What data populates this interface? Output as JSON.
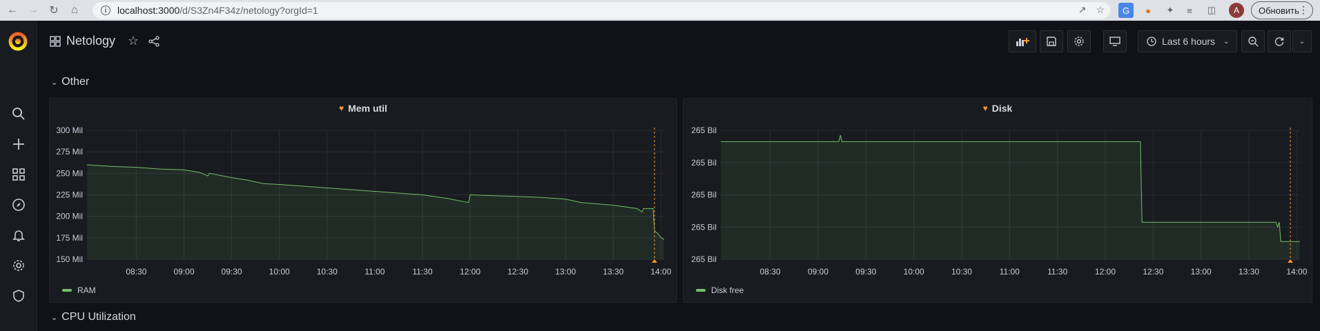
{
  "browser": {
    "url_host": "localhost:3000",
    "url_path": "/d/S3Zn4F34z/netology?orgId=1",
    "avatar_letter": "A",
    "update_label": "Обновить"
  },
  "dashboard": {
    "title": "Netology",
    "time_range": "Last 6 hours"
  },
  "rows": [
    {
      "title": "Other"
    },
    {
      "title": "CPU Utilization"
    }
  ],
  "panels": [
    {
      "title": "Mem util",
      "legend": "RAM"
    },
    {
      "title": "Disk",
      "legend": "Disk free"
    }
  ],
  "colors": {
    "series": "#73bf69",
    "accent": "#ff9830",
    "background": "#111217",
    "panel": "#181b1f"
  },
  "chart_data": [
    {
      "type": "line",
      "title": "Mem util",
      "series": [
        {
          "name": "RAM"
        }
      ],
      "y_tick_labels": [
        "150 Mil",
        "175 Mil",
        "200 Mil",
        "225 Mil",
        "250 Mil",
        "275 Mil",
        "300 Mil"
      ],
      "x_tick_labels": [
        "08:30",
        "09:00",
        "09:30",
        "10:00",
        "10:30",
        "11:00",
        "11:30",
        "12:00",
        "12:30",
        "13:00",
        "13:30",
        "14:00"
      ],
      "ylim": [
        150,
        300
      ],
      "x_range": [
        "07:59",
        "14:02"
      ],
      "points": [
        [
          "07:59",
          260
        ],
        [
          "08:15",
          258
        ],
        [
          "08:30",
          257
        ],
        [
          "08:45",
          255
        ],
        [
          "09:00",
          254
        ],
        [
          "09:10",
          251
        ],
        [
          "09:15",
          247
        ],
        [
          "09:16",
          250
        ],
        [
          "09:30",
          245
        ],
        [
          "09:40",
          242
        ],
        [
          "09:50",
          238
        ],
        [
          "10:00",
          237
        ],
        [
          "10:15",
          235
        ],
        [
          "10:30",
          233
        ],
        [
          "10:45",
          231
        ],
        [
          "11:00",
          229
        ],
        [
          "11:15",
          227
        ],
        [
          "11:30",
          225
        ],
        [
          "11:45",
          221
        ],
        [
          "11:59",
          216
        ],
        [
          "12:00",
          225
        ],
        [
          "12:15",
          224
        ],
        [
          "12:30",
          223
        ],
        [
          "12:45",
          222
        ],
        [
          "13:00",
          220
        ],
        [
          "13:10",
          216
        ],
        [
          "13:30",
          213
        ],
        [
          "13:45",
          209
        ],
        [
          "13:48",
          205
        ],
        [
          "13:49",
          209
        ],
        [
          "13:55",
          209
        ],
        [
          "13:56",
          183
        ],
        [
          "13:58",
          180
        ],
        [
          "14:00",
          175
        ],
        [
          "14:02",
          173
        ]
      ],
      "grid": true,
      "legend_position": "bottom-left"
    },
    {
      "type": "line",
      "title": "Disk",
      "series": [
        {
          "name": "Disk free"
        }
      ],
      "y_tick_labels": [
        "265 Bil",
        "265 Bil",
        "265 Bil",
        "265 Bil",
        "265 Bil"
      ],
      "x_tick_labels": [
        "08:30",
        "09:00",
        "09:30",
        "10:00",
        "10:30",
        "11:00",
        "11:30",
        "12:00",
        "12:30",
        "13:00",
        "13:30",
        "14:00"
      ],
      "x_range": [
        "07:59",
        "14:02"
      ],
      "ylim": [
        0,
        4
      ],
      "points": [
        [
          "07:59",
          3.65
        ],
        [
          "09:13",
          3.65
        ],
        [
          "09:14",
          3.85
        ],
        [
          "09:15",
          3.65
        ],
        [
          "12:22",
          3.65
        ],
        [
          "12:23",
          1.15
        ],
        [
          "13:47",
          1.15
        ],
        [
          "13:48",
          1.0
        ],
        [
          "13:49",
          1.15
        ],
        [
          "13:50",
          0.55
        ],
        [
          "14:02",
          0.55
        ]
      ],
      "grid": true,
      "legend_position": "bottom-left"
    }
  ]
}
